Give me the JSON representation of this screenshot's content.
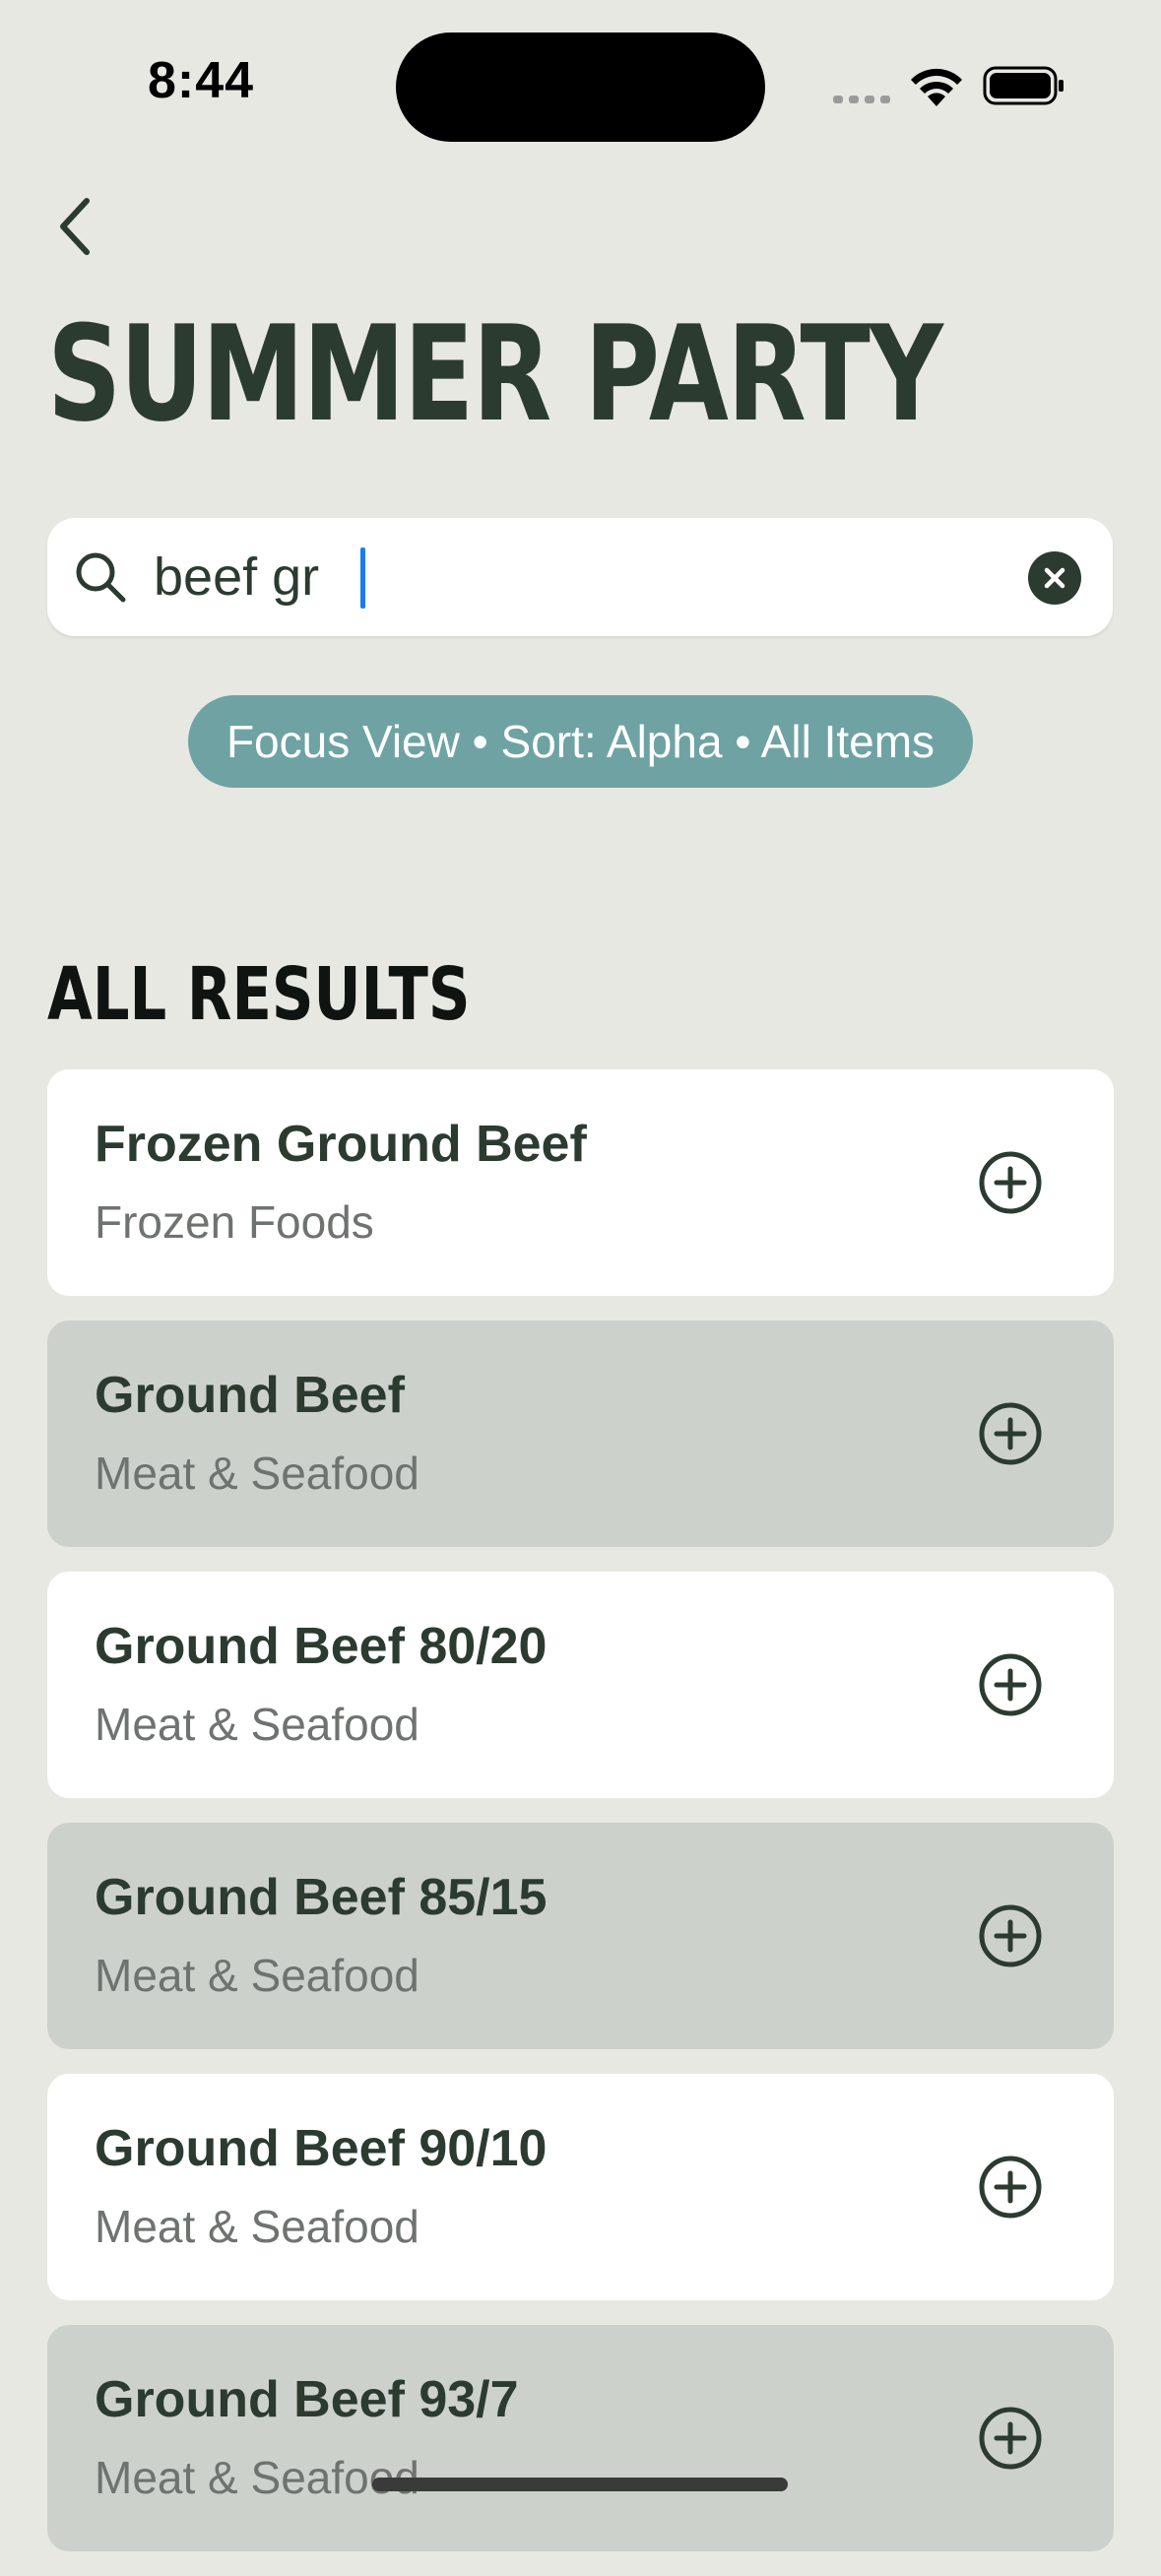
{
  "status_bar": {
    "time": "8:44",
    "icons": [
      "signal-icon",
      "wifi-icon",
      "battery-icon"
    ]
  },
  "header": {
    "back_icon": "chevron-left-icon",
    "title": "SUMMER PARTY"
  },
  "search": {
    "value": "beef gr",
    "placeholder": "",
    "search_icon": "search-icon",
    "clear_icon": "clear-icon"
  },
  "filter": {
    "label": "Focus View • Sort: Alpha • All Items"
  },
  "results": {
    "title": "ALL RESULTS",
    "items": [
      {
        "name": "Frozen Ground Beef",
        "category": "Frozen Foods"
      },
      {
        "name": "Ground Beef",
        "category": "Meat & Seafood"
      },
      {
        "name": "Ground Beef 80/20",
        "category": "Meat & Seafood"
      },
      {
        "name": "Ground Beef 85/15",
        "category": "Meat & Seafood"
      },
      {
        "name": "Ground Beef 90/10",
        "category": "Meat & Seafood"
      },
      {
        "name": "Ground Beef 93/7",
        "category": "Meat & Seafood"
      }
    ],
    "add_icon": "plus-circle-icon"
  },
  "colors": {
    "background": "#e8e8e3",
    "primary_text": "#2b3b30",
    "filter_pill": "#6fa3a3",
    "card_light": "#ffffff",
    "card_dark": "#cdd1cb",
    "caret": "#1a7cf0"
  }
}
